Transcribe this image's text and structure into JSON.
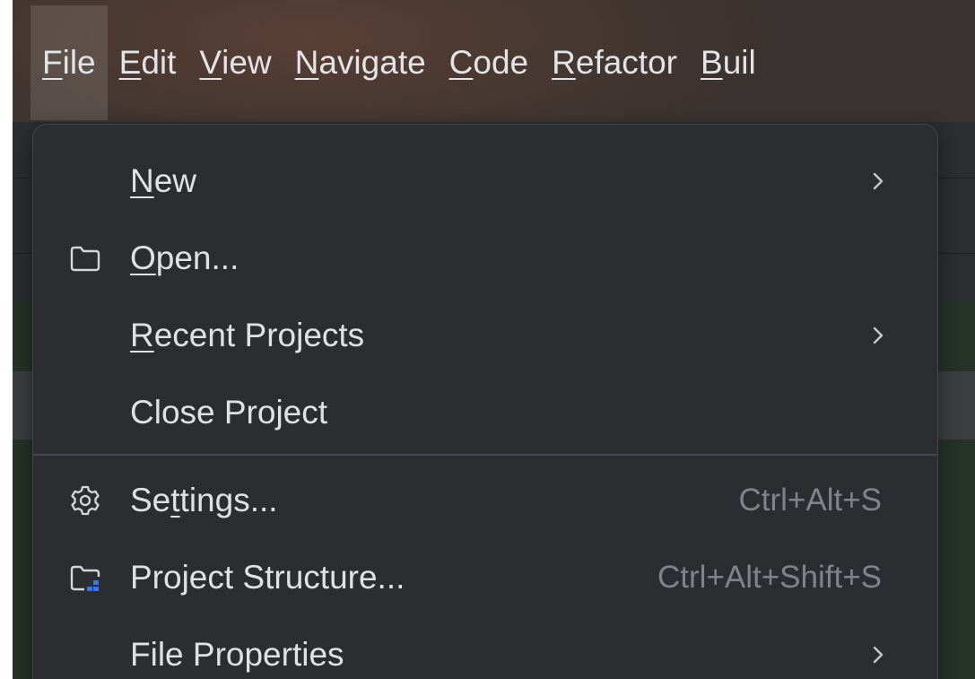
{
  "menubar": {
    "items": [
      {
        "mn": "F",
        "rest": "ile"
      },
      {
        "mn": "E",
        "rest": "dit"
      },
      {
        "mn": "V",
        "rest": "iew"
      },
      {
        "mn": "N",
        "rest": "avigate"
      },
      {
        "mn": "C",
        "rest": "ode"
      },
      {
        "mn": "R",
        "rest": "efactor"
      },
      {
        "mn": "B",
        "rest": "uil"
      }
    ]
  },
  "file_menu": {
    "new": {
      "mn": "N",
      "rest": "ew"
    },
    "open": {
      "mn": "O",
      "rest": "pen..."
    },
    "recent_projects": {
      "mn": "R",
      "rest": "ecent Projects"
    },
    "close_project": {
      "label": "Close Project"
    },
    "settings": {
      "pre": "Se",
      "mn": "t",
      "rest": "tings...",
      "shortcut": "Ctrl+Alt+S"
    },
    "project_structure": {
      "label": "Project Structure...",
      "shortcut": "Ctrl+Alt+Shift+S"
    },
    "file_properties": {
      "label": "File Properties"
    }
  },
  "icons": {
    "open": "folder-icon",
    "settings": "gear-icon",
    "project_structure": "project-structure-icon",
    "submenu": "chevron-right-icon"
  },
  "colors": {
    "menu_background": "#2b2d30",
    "menu_text": "#dfe1e5",
    "shortcut_text": "#80838a",
    "accent_blue": "#3574f0"
  }
}
